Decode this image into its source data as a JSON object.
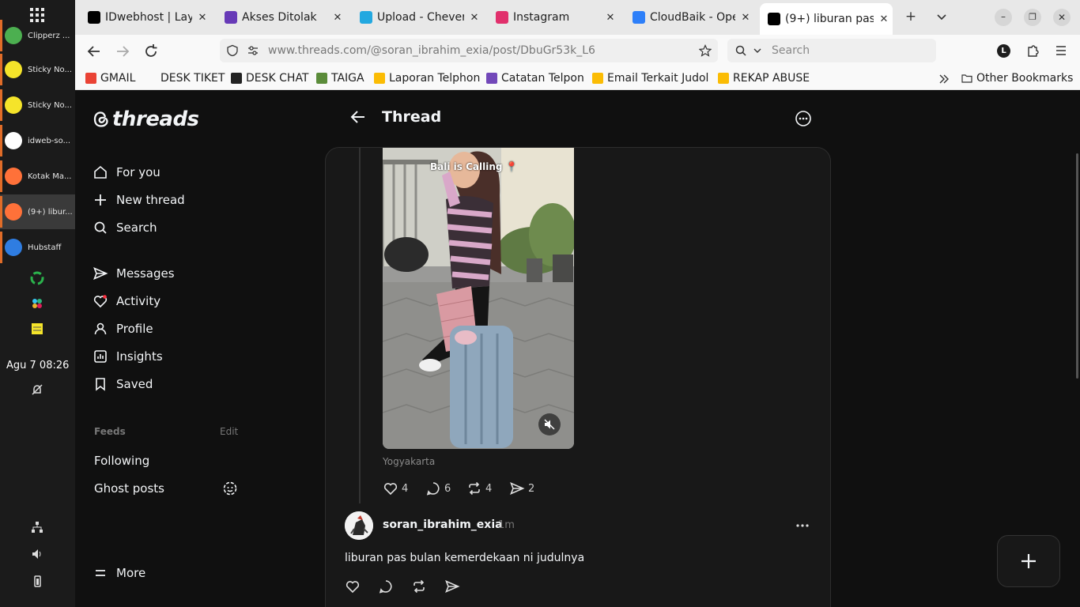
{
  "dock": {
    "apps": [
      {
        "label": "Clipperz ...",
        "color": "#4caf50",
        "active": false
      },
      {
        "label": "Sticky No...",
        "color": "#f5e42a",
        "active": false
      },
      {
        "label": "Sticky No...",
        "color": "#f5e42a",
        "active": false
      },
      {
        "label": "idweb-so...",
        "color": "#ffffff",
        "active": false
      },
      {
        "label": "Kotak Ma...",
        "color": "#ff7139",
        "active": false
      },
      {
        "label": "(9+) libur...",
        "color": "#ff7139",
        "active": true
      },
      {
        "label": "Hubstaff",
        "color": "#2f7de1",
        "active": false
      }
    ],
    "clock": "Agu 7  08:26"
  },
  "browser": {
    "tabs": [
      {
        "title": "IDwebhost | Layanan",
        "favicon": "x-icon",
        "color": "#000000",
        "active": false
      },
      {
        "title": "Akses Ditolak",
        "favicon": "forms-icon",
        "color": "#673ab7",
        "active": false
      },
      {
        "title": "Upload - Chevereto",
        "favicon": "chevereto-icon",
        "color": "#23a8e0",
        "active": false
      },
      {
        "title": "Instagram",
        "favicon": "instagram-icon",
        "color": "#e1306c",
        "active": false
      },
      {
        "title": "CloudBaik - OpenStack",
        "favicon": "cloud-icon",
        "color": "#2d7ff9",
        "active": false
      },
      {
        "title": "(9+) liburan pas bulan",
        "favicon": "threads-icon",
        "color": "#000000",
        "active": true
      }
    ],
    "url_host": "www.threads.com",
    "url_path": "/@soran_ibrahim_exia/post/DbuGr53k_L6",
    "search_placeholder": "Search",
    "profile_letter": "L",
    "bookmarks": [
      {
        "label": "GMAIL",
        "icon": "gmail-icon"
      },
      {
        "label": "DESK TIKET",
        "icon": "none"
      },
      {
        "label": "DESK CHAT",
        "icon": "desk-icon"
      },
      {
        "label": "TAIGA",
        "icon": "taiga-icon"
      },
      {
        "label": "Laporan Telphon",
        "icon": "drive-icon"
      },
      {
        "label": "Catatan Telpon",
        "icon": "forms-icon"
      },
      {
        "label": "Email Terkait Judol",
        "icon": "drive-icon"
      },
      {
        "label": "REKAP ABUSE",
        "icon": "drive-icon"
      }
    ],
    "other_bookmarks": "Other Bookmarks"
  },
  "threads": {
    "logo_text": "threads",
    "nav": [
      {
        "label": "For you",
        "icon": "home-icon"
      },
      {
        "label": "New thread",
        "icon": "plus-icon"
      },
      {
        "label": "Search",
        "icon": "search-icon"
      },
      {
        "label": "Messages",
        "icon": "send-icon"
      },
      {
        "label": "Activity",
        "icon": "heart-icon"
      },
      {
        "label": "Profile",
        "icon": "person-icon"
      },
      {
        "label": "Insights",
        "icon": "insights-icon"
      },
      {
        "label": "Saved",
        "icon": "bookmark-icon"
      }
    ],
    "feeds_heading": "Feeds",
    "feeds_edit": "Edit",
    "feeds": [
      "Following",
      "Ghost posts"
    ],
    "more_label": "More",
    "header_title": "Thread",
    "post": {
      "media_caption": "Bali is Calling 📍",
      "location": "Yogyakarta",
      "likes": "4",
      "replies": "6",
      "reposts": "4",
      "shares": "2"
    },
    "reply": {
      "username": "soran_ibrahim_exia",
      "time": "1m",
      "text": "liburan pas bulan kemerdekaan ni judulnya"
    }
  }
}
